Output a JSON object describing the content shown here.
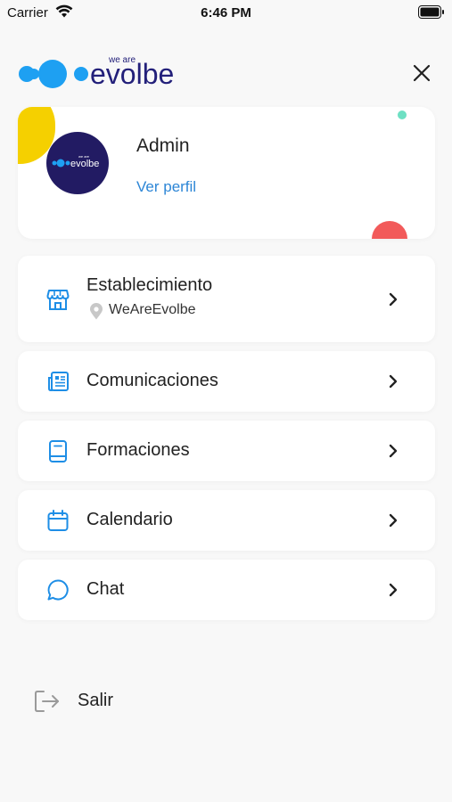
{
  "status_bar": {
    "carrier": "Carrier",
    "time": "6:46 PM"
  },
  "header": {
    "logo_small_text": "we are",
    "logo_text": "evolbe",
    "brand_color": "#23207a",
    "accent_color": "#1ea0f2"
  },
  "profile": {
    "name": "Admin",
    "link": "Ver perfil",
    "avatar_small_text": "we are",
    "avatar_text": "evolbe"
  },
  "menu": {
    "items": [
      {
        "label": "Establecimiento",
        "icon": "store-icon",
        "sublabel": "WeAreEvolbe",
        "sub_icon": "location-pin-icon"
      },
      {
        "label": "Comunicaciones",
        "icon": "newspaper-icon"
      },
      {
        "label": "Formaciones",
        "icon": "book-icon"
      },
      {
        "label": "Calendario",
        "icon": "calendar-icon"
      },
      {
        "label": "Chat",
        "icon": "chat-bubble-icon"
      }
    ]
  },
  "logout": {
    "label": "Salir",
    "icon": "logout-icon"
  },
  "colors": {
    "icon_blue": "#1e8ee6",
    "link_blue": "#2d86d6",
    "yellow": "#f5d000",
    "teal": "#6ee0c3",
    "red": "#f25a5a"
  }
}
